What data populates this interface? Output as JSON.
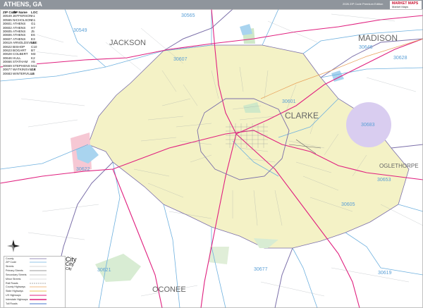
{
  "header": {
    "title": "ATHENS, GA",
    "edition": "2026 ZIP Code Premium Edition",
    "logo_line1": "MARKET MAPS",
    "logo_line2": "Market Maps"
  },
  "zip_table": {
    "headers": [
      "ZIP Code",
      "ZIP Name",
      "LOC"
    ],
    "rows": [
      [
        "30549",
        "JEFFERSON",
        "A1"
      ],
      [
        "30565",
        "NICHOLSON",
        "G1"
      ],
      [
        "30601",
        "ATHENS",
        "G1"
      ],
      [
        "30602",
        "ATHENS",
        "H7"
      ],
      [
        "30605",
        "ATHENS",
        "J5"
      ],
      [
        "30606",
        "ATHENS",
        "E6"
      ],
      [
        "30607",
        "ATHENS",
        "E3"
      ],
      [
        "30619",
        "ARNOLDSVILLE",
        "M8"
      ],
      [
        "30622",
        "BISHOP",
        "C10"
      ],
      [
        "30623",
        "BOGART",
        "B7"
      ],
      [
        "30628",
        "COLBERT",
        "M3"
      ],
      [
        "30646",
        "HULL",
        "K2"
      ],
      [
        "30666",
        "STATHAM",
        "A5"
      ],
      [
        "30669",
        "STEPHENS",
        "M11"
      ],
      [
        "30677",
        "WATKINSVILLE",
        "G9"
      ],
      [
        "30683",
        "WINTERVILLE",
        "L6"
      ]
    ]
  },
  "counties": [
    {
      "name": "JACKSON"
    },
    {
      "name": "MADISON"
    },
    {
      "name": "CLARKE"
    },
    {
      "name": "OGLETHORPE"
    },
    {
      "name": "OCONEE"
    }
  ],
  "zip_labels": [
    {
      "zip": "30565"
    },
    {
      "zip": "30549"
    },
    {
      "zip": "30646"
    },
    {
      "zip": "30628"
    },
    {
      "zip": "30607"
    },
    {
      "zip": "30601"
    },
    {
      "zip": "30683"
    },
    {
      "zip": "30622"
    },
    {
      "zip": "30653"
    },
    {
      "zip": "30605"
    },
    {
      "zip": "30621"
    },
    {
      "zip": "30677"
    },
    {
      "zip": "30619"
    }
  ],
  "city_sizes": [
    "City",
    "City",
    "City"
  ],
  "legend": {
    "rows": [
      "County",
      "ZIP Code",
      "Streets",
      "Primary Streets",
      "Secondary Streets",
      "Minor Streets",
      "Rail Roads",
      "County Highways",
      "State Highways",
      "US Highways",
      "Interstate Highways",
      "Toll Roads"
    ]
  },
  "colors": {
    "clarke_fill": "#f4f2c6",
    "zip_boundary": "#6fb1df",
    "county_boundary": "#7b6fa9",
    "highway": "#e0207f",
    "green_area": "#d8ecd3",
    "water": "#a9d4ef",
    "purple_area": "#d9cdf0",
    "pink_area": "#f6c8d4",
    "zip_label": "#5a9fd6"
  }
}
